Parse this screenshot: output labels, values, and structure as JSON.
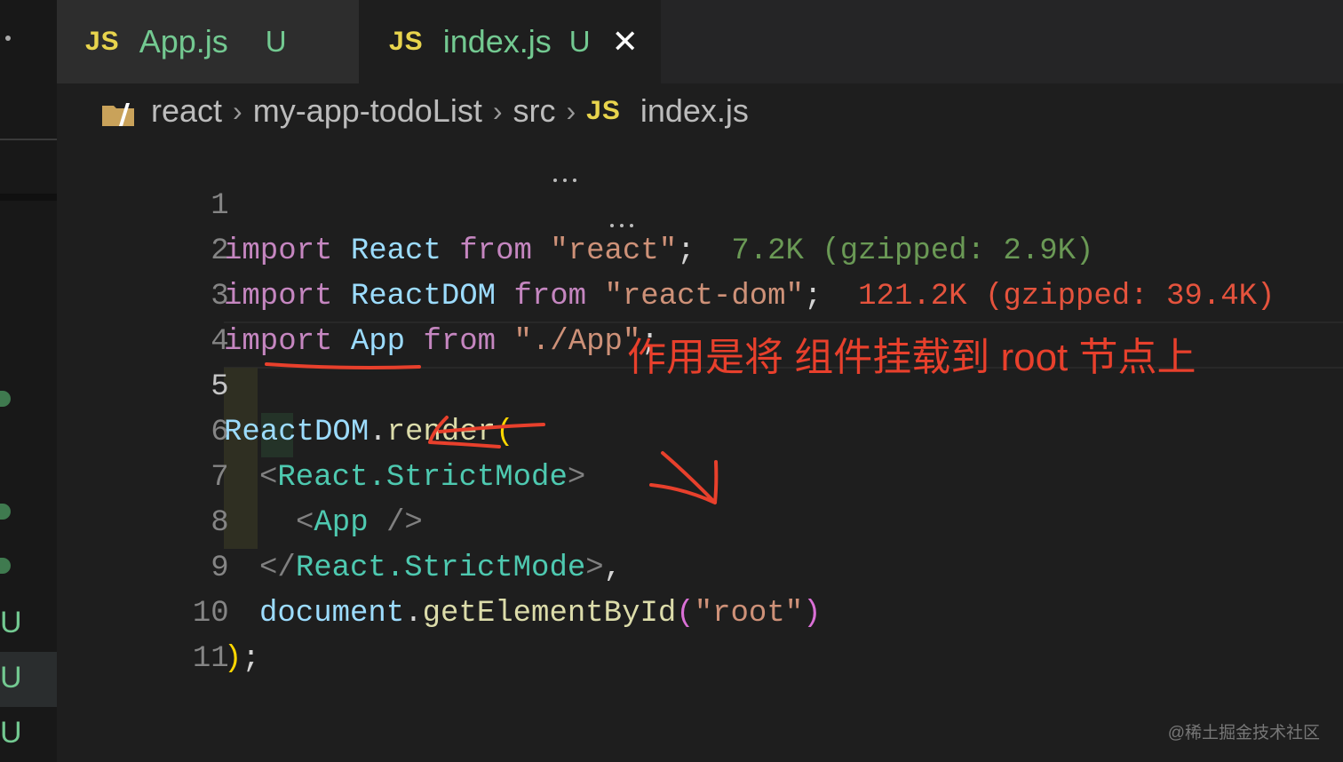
{
  "tabs": [
    {
      "icon": "JS",
      "name": "App.js",
      "status": "U"
    },
    {
      "icon": "JS",
      "name": "index.js",
      "status": "U",
      "close": "✕"
    }
  ],
  "breadcrumb": {
    "parts": [
      "react",
      "my-app-todoList",
      "src"
    ],
    "file_icon": "JS",
    "file": "index.js",
    "separator": "›"
  },
  "code": {
    "line_numbers": [
      "1",
      "2",
      "3",
      "4",
      "5",
      "6",
      "7",
      "8",
      "9",
      "10",
      "11"
    ],
    "active_line": "5",
    "l1": {
      "import": "import",
      "name": "React",
      "from": "from",
      "module": "\"react\"",
      "semi": ";",
      "size": "7.2K (gzipped: 2.9K)"
    },
    "l2": {
      "import": "import",
      "name": "ReactDOM",
      "from": "from",
      "module": "\"react-dom\"",
      "semi": ";",
      "size": "121.2K (gzipped: 39.4K)"
    },
    "l3": {
      "import": "import",
      "name": "App",
      "from": "from",
      "module": "\"./App\"",
      "semi": ";"
    },
    "l5": {
      "obj": "ReactDOM",
      "dot": ".",
      "method": "render",
      "paren": "("
    },
    "l6": {
      "open": "<",
      "tag": "React.StrictMode",
      "close": ">"
    },
    "l7": {
      "open": "<",
      "tag": "App",
      "close": " />"
    },
    "l8": {
      "open": "</",
      "tag": "React.StrictMode",
      "close": ">",
      "comma": ","
    },
    "l9": {
      "obj": "document",
      "dot": ".",
      "method": "getElementById",
      "lp": "(",
      "arg": "\"root\"",
      "rp": ")"
    },
    "l10": {
      "paren": ")",
      "semi": ";"
    }
  },
  "annotation": "作用是将 组件挂载到 root 节点上",
  "watermark": "@稀土掘金技术社区",
  "side_markers": [
    "U",
    "U",
    "U"
  ],
  "colors": {
    "annotation": "#e8402c",
    "js_icon": "#e8d44d",
    "untracked": "#73c991"
  }
}
